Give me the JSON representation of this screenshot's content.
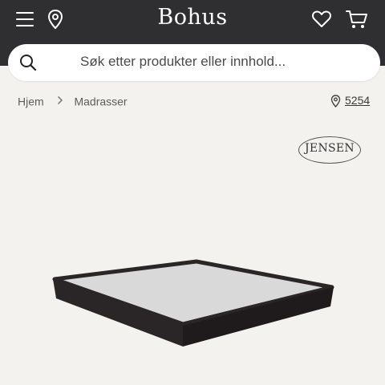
{
  "header": {
    "brand": "Bohus",
    "icons": [
      "menu-icon",
      "location-pin-icon",
      "heart-icon",
      "cart-icon"
    ],
    "background": "#2f2f31"
  },
  "search": {
    "placeholder": "Søk etter produkter eller innhold..."
  },
  "breadcrumb": {
    "items": [
      "Hjem",
      "Madrasser"
    ],
    "separator_icon": "chevron-right-icon"
  },
  "store": {
    "number": "5254",
    "icon": "location-pin-icon"
  },
  "product": {
    "brand_logo": "JENSEN",
    "image": "box-spring-mattress-base",
    "colors": {
      "frame": "#2a2526",
      "top": "#d9d9d9"
    }
  }
}
